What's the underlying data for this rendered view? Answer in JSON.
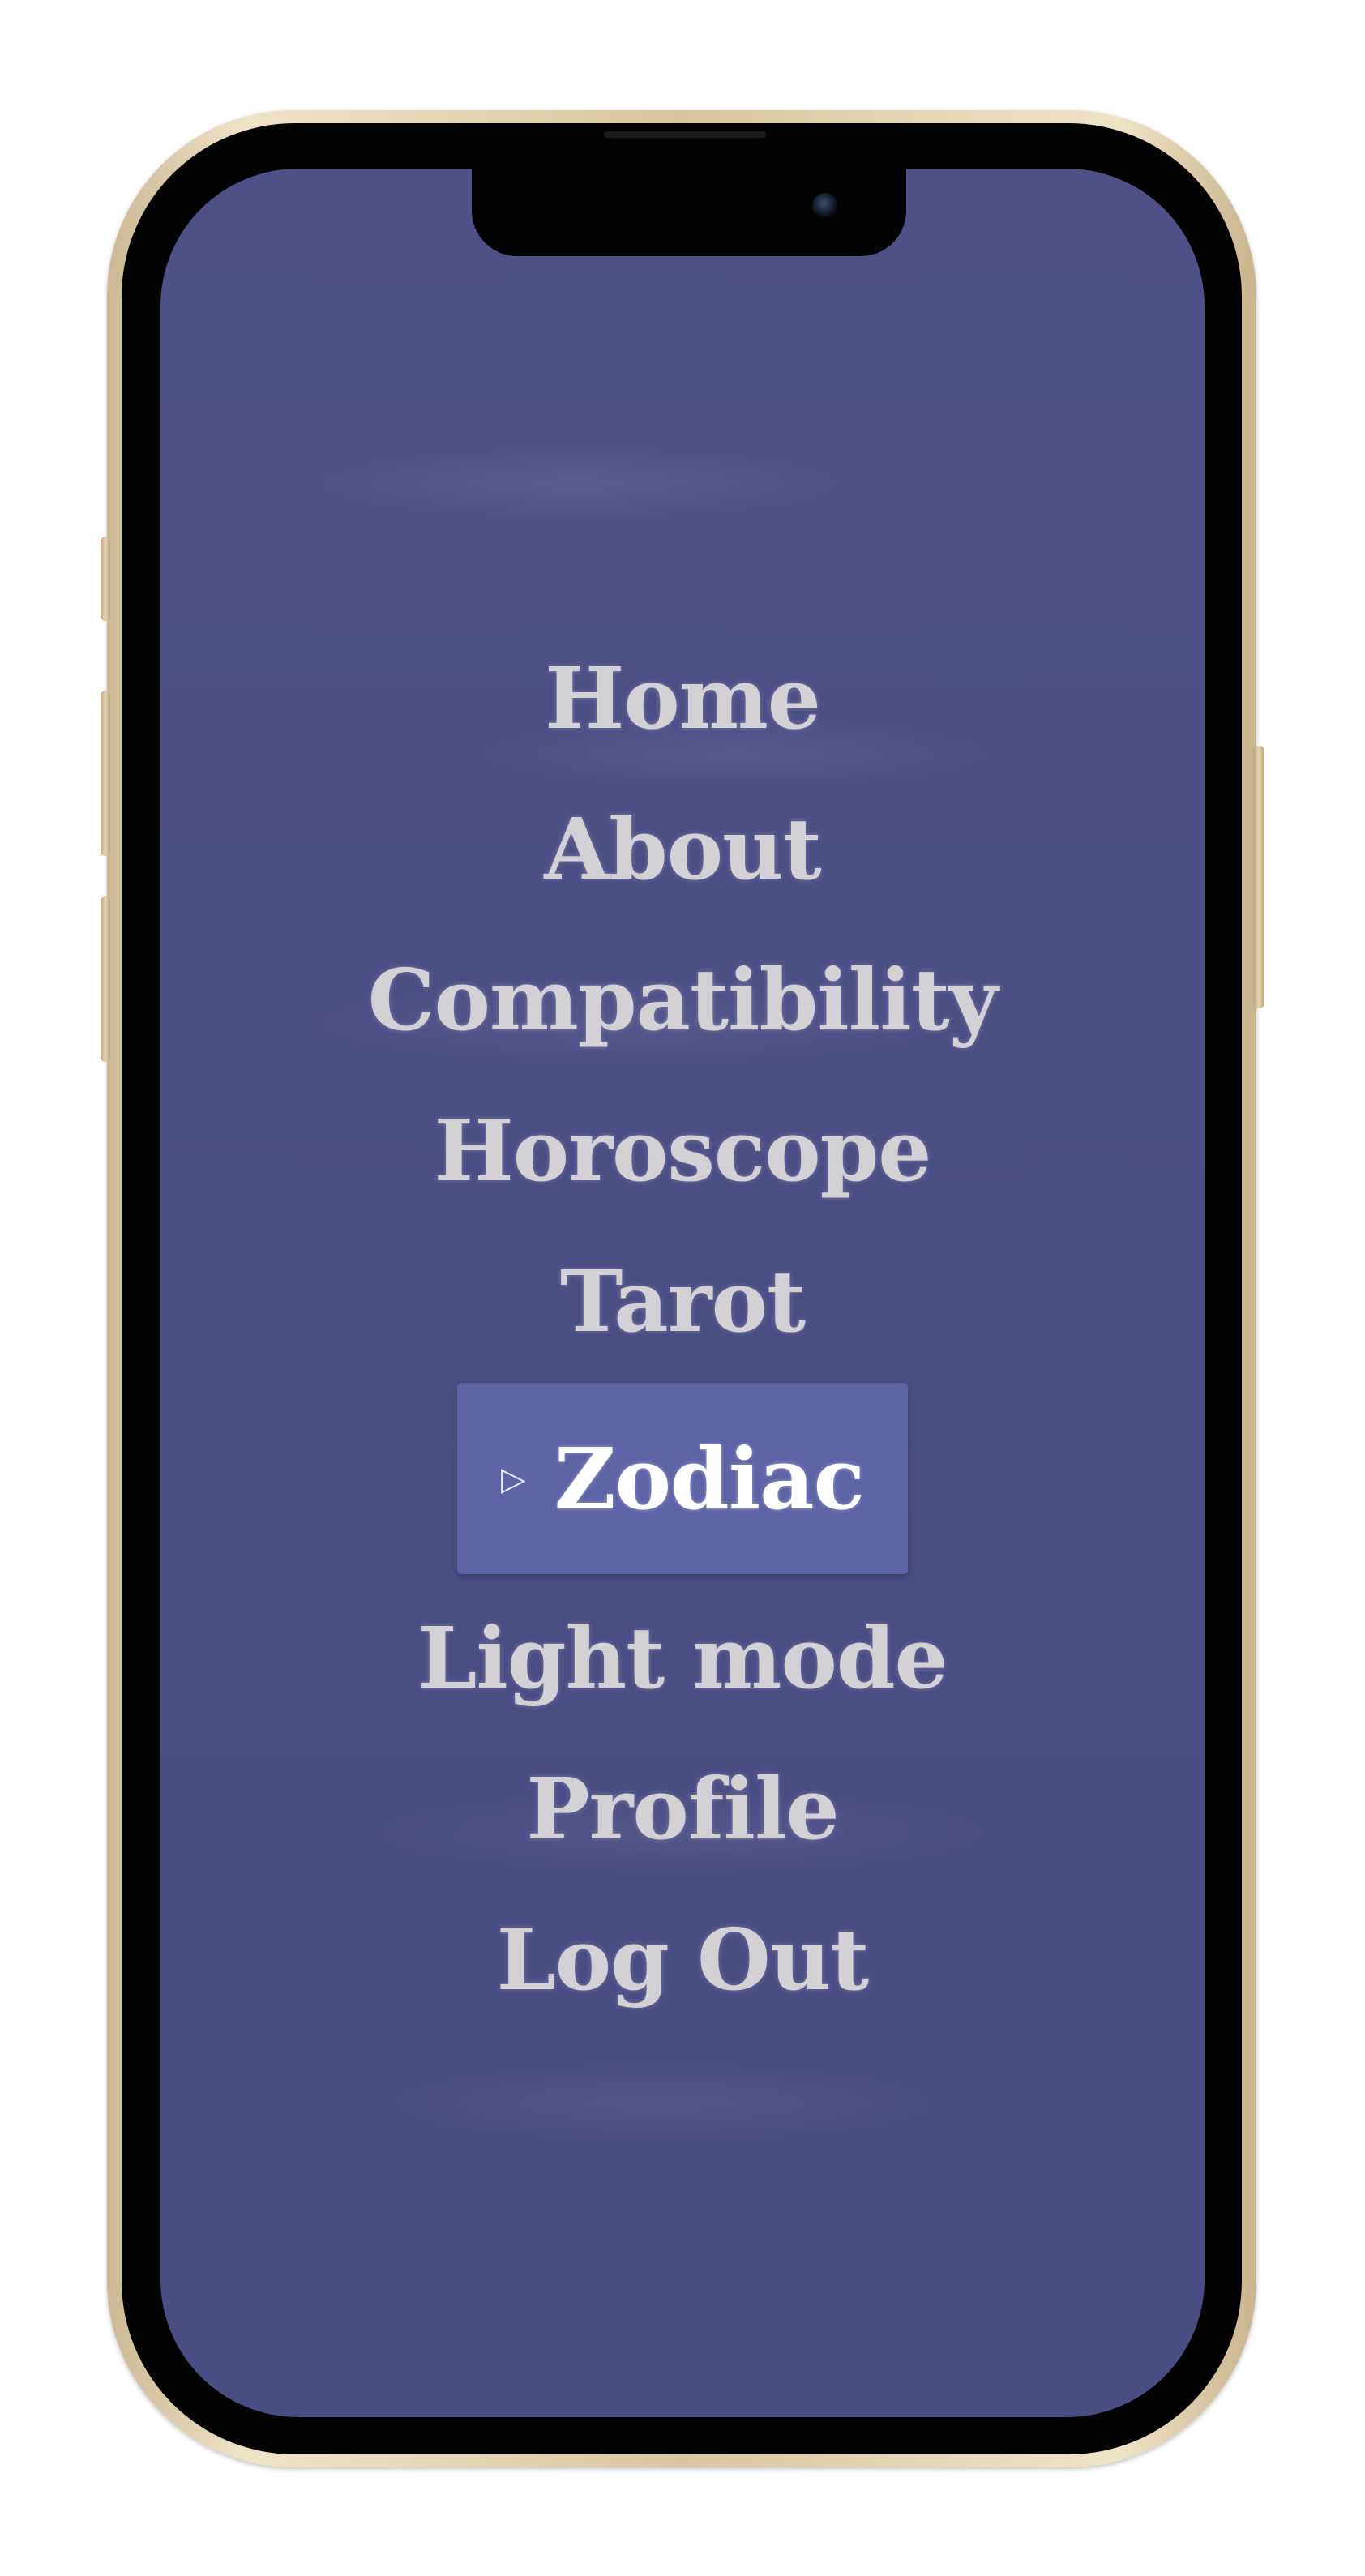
{
  "menu": {
    "items": [
      {
        "label": "Home",
        "active": false
      },
      {
        "label": "About",
        "active": false
      },
      {
        "label": "Compatibility",
        "active": false
      },
      {
        "label": "Horoscope",
        "active": false
      },
      {
        "label": "Tarot",
        "active": false
      },
      {
        "label": "Zodiac",
        "active": true,
        "indicator": "▷"
      },
      {
        "label": "Light mode",
        "active": false
      },
      {
        "label": "Profile",
        "active": false
      },
      {
        "label": "Log Out",
        "active": false
      }
    ]
  },
  "colors": {
    "background": "#4b4d85",
    "active_item": "#5e63a6",
    "text": "#d3d0d6",
    "active_text": "#ffffff",
    "frame": "#d8c6a0"
  }
}
